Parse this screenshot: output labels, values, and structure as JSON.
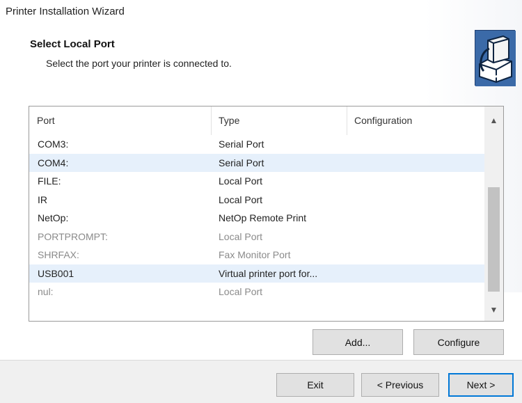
{
  "window": {
    "title": "Printer Installation Wizard"
  },
  "header": {
    "title": "Select Local Port",
    "subtitle": "Select the port your printer is connected to.",
    "icon": "printer-wizard-icon"
  },
  "port_list": {
    "columns": [
      "Port",
      "Type",
      "Configuration"
    ],
    "rows": [
      {
        "port": "COM3:",
        "type": "Serial Port",
        "configuration": "",
        "selected": false,
        "dim": false
      },
      {
        "port": "COM4:",
        "type": "Serial Port",
        "configuration": "",
        "selected": true,
        "dim": false
      },
      {
        "port": "FILE:",
        "type": "Local Port",
        "configuration": "",
        "selected": false,
        "dim": false
      },
      {
        "port": "IR",
        "type": "Local Port",
        "configuration": "",
        "selected": false,
        "dim": false
      },
      {
        "port": "NetOp:",
        "type": "NetOp Remote Print",
        "configuration": "",
        "selected": false,
        "dim": false
      },
      {
        "port": "PORTPROMPT:",
        "type": "Local Port",
        "configuration": "",
        "selected": false,
        "dim": true
      },
      {
        "port": "SHRFAX:",
        "type": "Fax Monitor Port",
        "configuration": "",
        "selected": false,
        "dim": true
      },
      {
        "port": "USB001",
        "type": "Virtual printer port for...",
        "configuration": "",
        "selected": true,
        "dim": false
      },
      {
        "port": "nul:",
        "type": "Local Port",
        "configuration": "",
        "selected": false,
        "dim": true
      }
    ]
  },
  "buttons": {
    "add": "Add...",
    "configure": "Configure",
    "exit": "Exit",
    "previous": "< Previous",
    "next": "Next >"
  },
  "colors": {
    "selection": "#e6f0fb",
    "accent": "#0078d7",
    "footer_bg": "#f0f0f0"
  }
}
